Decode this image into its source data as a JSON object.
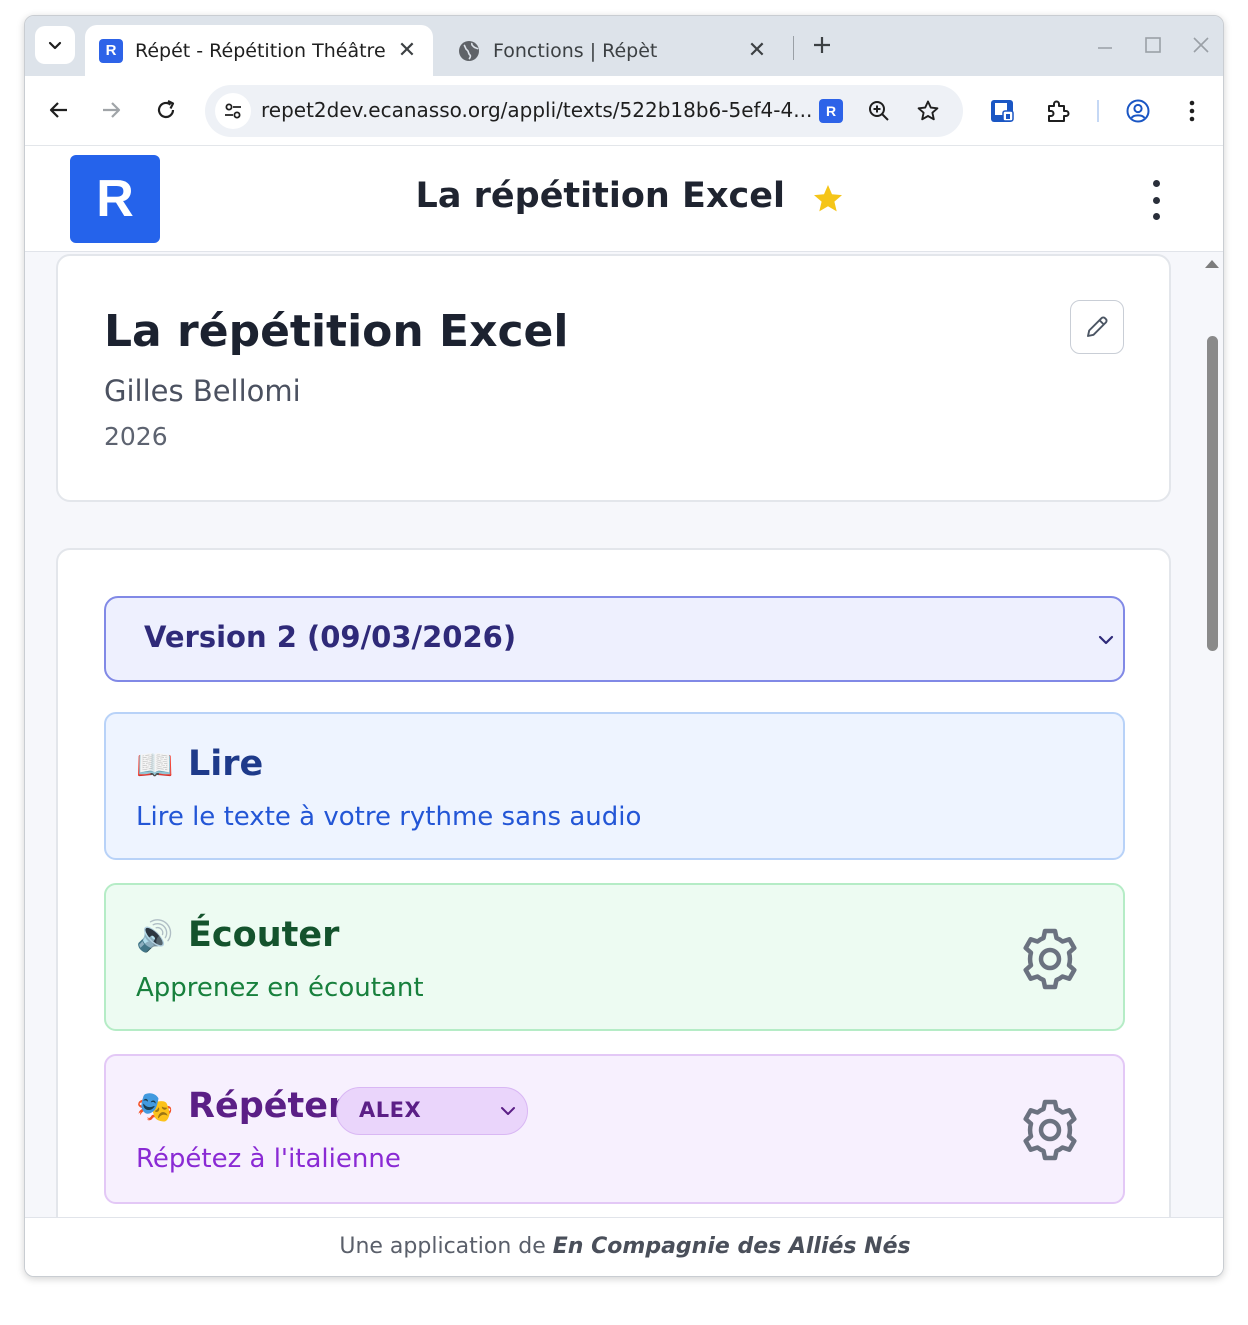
{
  "browser": {
    "tabs": [
      {
        "title": "Répét - Répétition Théâtre",
        "favicon": "R",
        "active": true
      },
      {
        "title": "Fonctions | Répèt",
        "favicon": "globe-icon",
        "active": false
      }
    ],
    "url": "repet2dev.ecanasso.org/appli/texts/522b18b6-5ef4-4...",
    "omnibox_extension": "R"
  },
  "app": {
    "logo_letter": "R",
    "header_title": "La répétition Excel",
    "favorite": true,
    "accent_color": "#2563eb",
    "star_color": "#f5c518"
  },
  "play": {
    "title": "La répétition Excel",
    "author": "Gilles Bellomi",
    "year": "2026"
  },
  "version_select": {
    "selected": "Version 2 (09/03/2026)"
  },
  "modes": {
    "read": {
      "emoji": "📖",
      "title": "Lire",
      "description": "Lire le texte à votre rythme sans audio"
    },
    "listen": {
      "emoji": "🔊",
      "title": "Écouter",
      "description": "Apprenez en écoutant"
    },
    "repeat": {
      "emoji": "🎭",
      "title": "Répéter",
      "description": "Répétez à l'italienne",
      "role_selected": "ALEX"
    }
  },
  "footer": {
    "prefix": "Une application de",
    "org": "En Compagnie des Alliés Nés"
  }
}
